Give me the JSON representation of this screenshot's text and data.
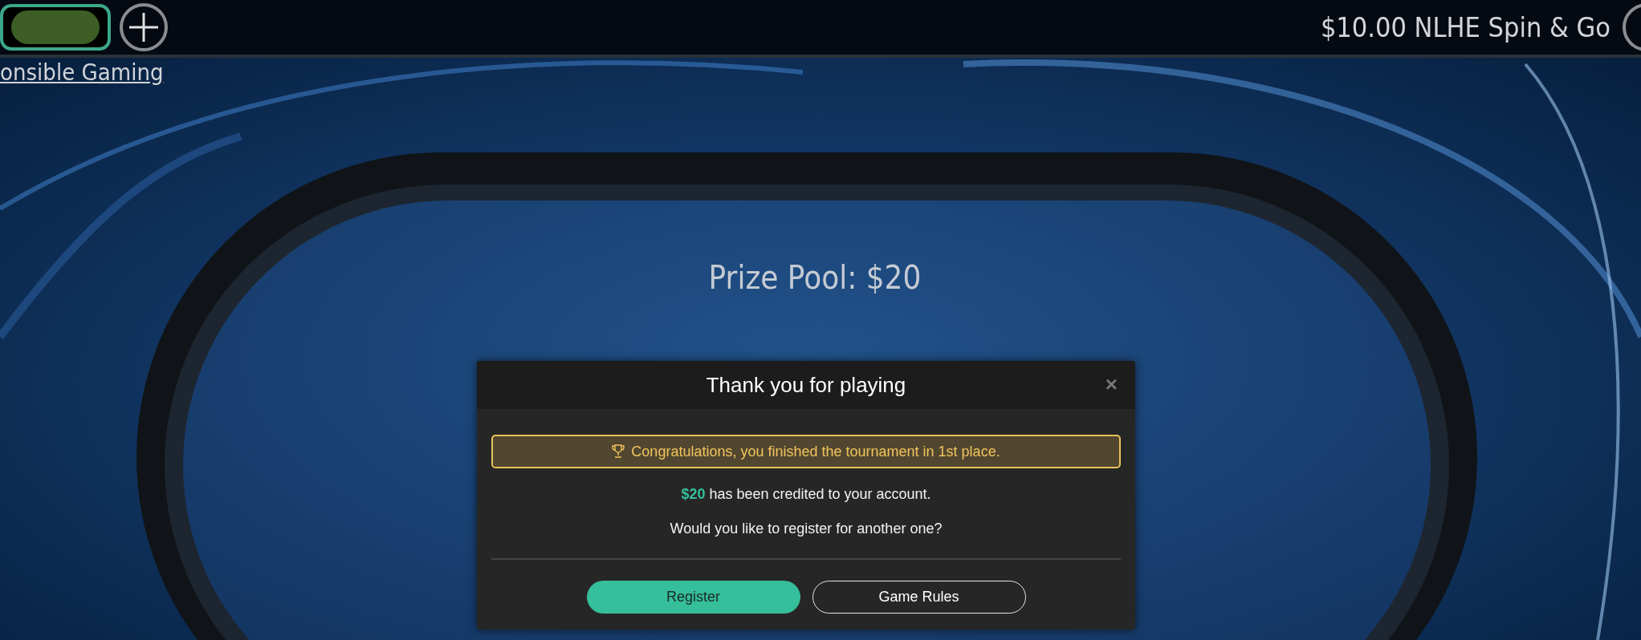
{
  "top_bar": {
    "tabs": [
      {
        "kind": "table",
        "selected": true
      }
    ],
    "title": "$10.00 NLHE Spin & Go"
  },
  "responsible_gaming_link": "onsible Gaming",
  "table": {
    "prize_pool": "Prize Pool: $20"
  },
  "dialog": {
    "title": "Thank you for playing",
    "close": "×",
    "banner": "Congratulations, you finished the tournament in 1st place.",
    "credited": "**$20** has been credited to your account.",
    "question": "Would you like to register for another one?",
    "buttons": [
      {
        "label": "Register",
        "kind": "primary"
      },
      {
        "label": "Game Rules",
        "kind": "secondary"
      }
    ]
  }
}
